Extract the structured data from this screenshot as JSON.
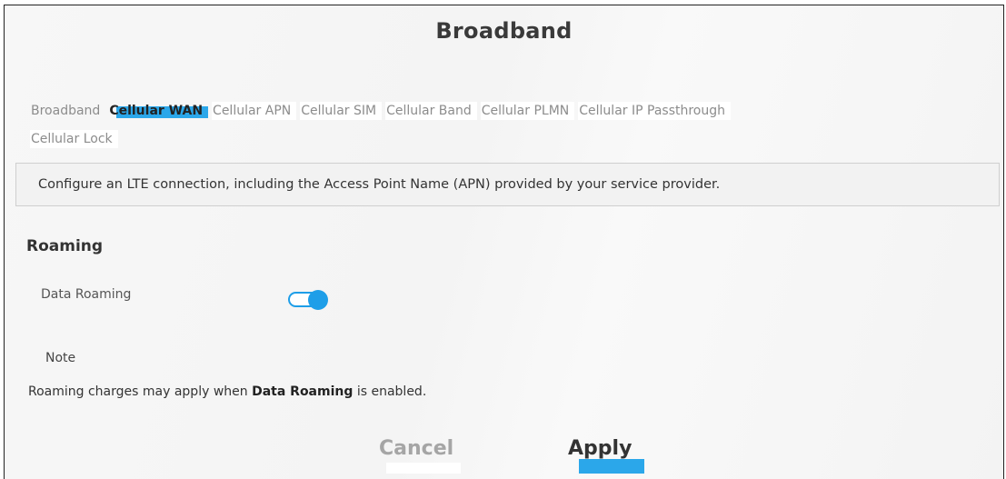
{
  "header": {
    "title": "Broadband"
  },
  "tabs": {
    "row1": [
      {
        "label": "Broadband",
        "active": false
      },
      {
        "label": "Cellular WAN",
        "active": true
      },
      {
        "label": "Cellular APN",
        "active": false
      },
      {
        "label": "Cellular SIM",
        "active": false
      },
      {
        "label": "Cellular Band",
        "active": false
      },
      {
        "label": "Cellular PLMN",
        "active": false
      },
      {
        "label": "Cellular IP Passthrough",
        "active": false
      }
    ],
    "row2": [
      {
        "label": "Cellular Lock",
        "active": false
      }
    ]
  },
  "info": {
    "text": "Configure an LTE connection, including the Access Point Name (APN) provided by your service provider."
  },
  "roaming": {
    "section_title": "Roaming",
    "data_roaming_label": "Data Roaming",
    "data_roaming_enabled": true
  },
  "note": {
    "label": "Note",
    "text_before": "Roaming charges may apply when ",
    "text_bold": "Data Roaming",
    "text_after": " is enabled."
  },
  "buttons": {
    "cancel": "Cancel",
    "apply": "Apply"
  },
  "colors": {
    "accent": "#2ba7ea",
    "toggle": "#1e9ee8"
  }
}
